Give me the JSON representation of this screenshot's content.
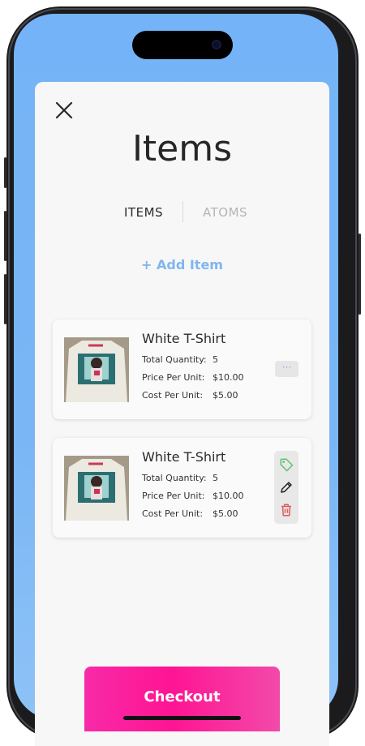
{
  "header": {
    "title": "Items",
    "close_icon": "close-icon"
  },
  "tabs": [
    {
      "label": "ITEMS",
      "active": true
    },
    {
      "label": "ATOMS",
      "active": false
    }
  ],
  "add_item": {
    "label": "+ Add Item"
  },
  "items": [
    {
      "name": "White T-Shirt",
      "rows": [
        {
          "label": "Total Quantity:",
          "value": "5"
        },
        {
          "label": "Price Per Unit:",
          "value": "$10.00"
        },
        {
          "label": "Cost Per Unit:",
          "value": "$5.00"
        }
      ],
      "menu": {
        "icon": "more-dots-icon",
        "label": "···"
      }
    },
    {
      "name": "White T-Shirt",
      "rows": [
        {
          "label": "Total Quantity:",
          "value": "5"
        },
        {
          "label": "Price Per Unit:",
          "value": "$10.00"
        },
        {
          "label": "Cost Per Unit:",
          "value": "$5.00"
        }
      ],
      "actions": [
        {
          "icon": "tag-icon",
          "color": "#5cc46a"
        },
        {
          "icon": "pencil-icon",
          "color": "#222222"
        },
        {
          "icon": "trash-icon",
          "color": "#e05a5a"
        }
      ]
    }
  ],
  "checkout": {
    "label": "Checkout"
  },
  "colors": {
    "accent_blue": "#7fb6f0",
    "checkout_pink": "#ff1493",
    "screen_background": "#74b3f7"
  }
}
